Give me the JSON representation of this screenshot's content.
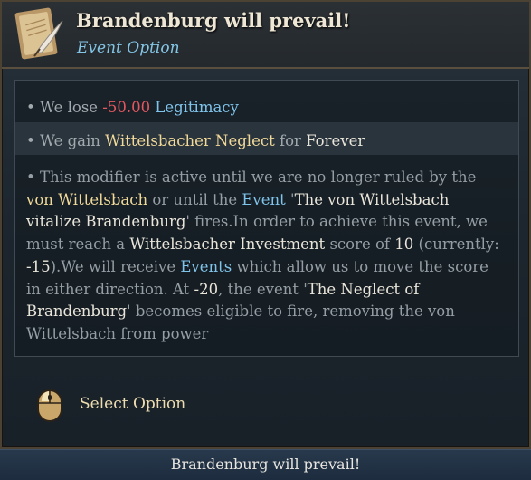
{
  "header": {
    "title": "Brandenburg will prevail!",
    "subtitle": "Event Option",
    "icon": "scroll-quill-icon"
  },
  "effects": {
    "line1": {
      "bullet": "•",
      "prefix": "We lose ",
      "amount": "-50.00",
      "target": "Legitimacy"
    },
    "line2": {
      "bullet": "•",
      "prefix": "We gain ",
      "modifier": "Wittelsbacher Neglect",
      "middle": " for ",
      "duration": "Forever"
    },
    "note": {
      "bullet": "•",
      "t1": "This modifier is active until we are no longer ruled by the",
      "h1": "von Wittelsbach",
      "t2": " or until the ",
      "h2": "Event",
      "t3": " '",
      "h3": "The von Wittelsbach vitalize Brandenburg",
      "t4": "' fires.In order to achieve this event, we must reach a ",
      "h4": "Wittelsbacher Investment",
      "t5": " score of ",
      "h5": "10",
      "t6": " (currently: ",
      "h6": "-15",
      "t7": ").We will receive ",
      "h7": "Events",
      "t8": " which allow us to move the score in either direction. At ",
      "h8": "-20",
      "t9": ", the event '",
      "h9": "The Neglect of Brandenburg",
      "t10": "' becomes eligible to fire, removing the von Wittelsbach from power"
    }
  },
  "action": {
    "label": "Select Option",
    "icon": "mouse-left-click-icon"
  },
  "footer": {
    "text": "Brandenburg will prevail!"
  },
  "colors": {
    "highlight_yellow": "#f0d999",
    "highlight_blue": "#7fc4eb",
    "negative_red": "#e3575f",
    "subtitle_blue": "#84c6e6"
  }
}
